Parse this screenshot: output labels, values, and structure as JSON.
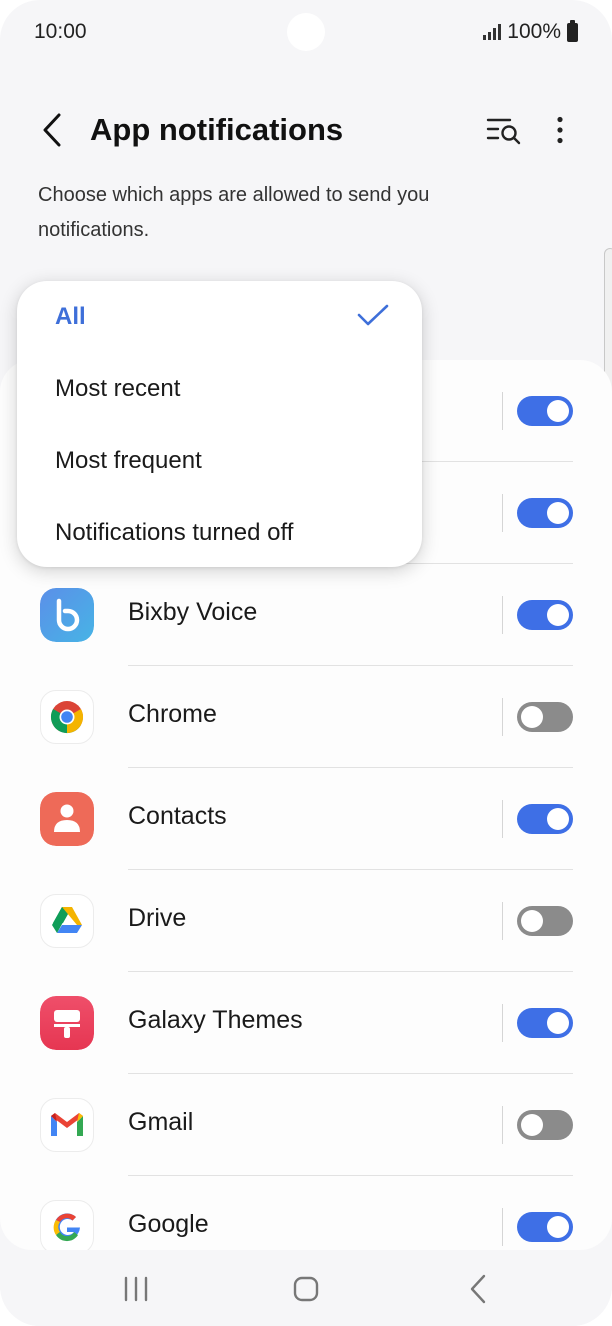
{
  "status": {
    "time": "10:00",
    "battery": "100%"
  },
  "header": {
    "title": "App notifications"
  },
  "subtitle": "Choose which apps are allowed to send you notifications.",
  "filter_menu": {
    "items": [
      {
        "label": "All",
        "selected": true
      },
      {
        "label": "Most recent",
        "selected": false
      },
      {
        "label": "Most frequent",
        "selected": false
      },
      {
        "label": "Notifications turned off",
        "selected": false
      }
    ]
  },
  "apps": [
    {
      "name": "Bixby Voice",
      "icon": "bixby-voice-icon",
      "enabled": true
    },
    {
      "name": "Chrome",
      "icon": "chrome-icon",
      "enabled": false
    },
    {
      "name": "Contacts",
      "icon": "contacts-icon",
      "enabled": true
    },
    {
      "name": "Drive",
      "icon": "drive-icon",
      "enabled": false
    },
    {
      "name": "Galaxy Themes",
      "icon": "galaxy-themes-icon",
      "enabled": true
    },
    {
      "name": "Gmail",
      "icon": "gmail-icon",
      "enabled": false
    },
    {
      "name": "Google",
      "icon": "google-icon",
      "enabled": true
    }
  ],
  "hidden_rows_toggles": [
    true,
    true
  ],
  "colors": {
    "accent": "#3e6fe6",
    "toggle_off": "#8b8b8b",
    "selected_text": "#3e6fd9"
  }
}
